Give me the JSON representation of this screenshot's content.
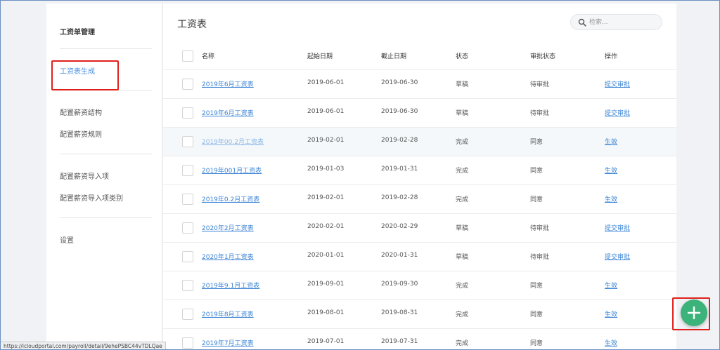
{
  "sidebar": {
    "title": "工资单管理",
    "active_item": "工资表生成",
    "items": [
      "配置薪资结构",
      "配置薪资规则",
      "配置薪资导入项",
      "配置薪资导入项类别",
      "设置"
    ]
  },
  "main": {
    "title": "工资表",
    "search_placeholder": "检索..."
  },
  "table": {
    "columns": [
      "名称",
      "起始日期",
      "截止日期",
      "状态",
      "审批状态",
      "操作"
    ],
    "rows": [
      {
        "name": "2019年6月工资表",
        "start": "2019-06-01",
        "end": "2019-06-30",
        "status": "草稿",
        "approval": "待审批",
        "action": "提交审批"
      },
      {
        "name": "2019年6月工资表",
        "start": "2019-06-01",
        "end": "2019-06-30",
        "status": "草稿",
        "approval": "待审批",
        "action": "提交审批"
      },
      {
        "name": "2019年00.2月工资表",
        "start": "2019-02-01",
        "end": "2019-02-28",
        "status": "完成",
        "approval": "同意",
        "action": "生效"
      },
      {
        "name": "2019年001月工资表",
        "start": "2019-01-03",
        "end": "2019-01-31",
        "status": "完成",
        "approval": "同意",
        "action": "生效"
      },
      {
        "name": "2019年0.2月工资表",
        "start": "2019-02-01",
        "end": "2019-02-28",
        "status": "完成",
        "approval": "同意",
        "action": "生效"
      },
      {
        "name": "2020年2月工资表",
        "start": "2020-02-01",
        "end": "2020-02-29",
        "status": "草稿",
        "approval": "待审批",
        "action": "提交审批"
      },
      {
        "name": "2020年1月工资表",
        "start": "2020-01-01",
        "end": "2020-01-31",
        "status": "草稿",
        "approval": "待审批",
        "action": "提交审批"
      },
      {
        "name": "2019年9.1月工资表",
        "start": "2019-09-01",
        "end": "2019-09-30",
        "status": "完成",
        "approval": "同意",
        "action": "生效"
      },
      {
        "name": "2019年8月工资表",
        "start": "2019-08-01",
        "end": "2019-08-31",
        "status": "完成",
        "approval": "同意",
        "action": "生效"
      },
      {
        "name": "2019年7月工资表",
        "start": "2019-07-01",
        "end": "2019-07-31",
        "status": "完成",
        "approval": "同意",
        "action": "生效"
      }
    ]
  },
  "fab": {
    "icon": "plus-icon",
    "color": "#3bb37a"
  },
  "statusbar": {
    "url": "https://icloudportal.com/payroll/detail/9ehePSBC44vTDLQae"
  },
  "colors": {
    "link": "#3a83d4",
    "highlight": "#e0201b"
  }
}
